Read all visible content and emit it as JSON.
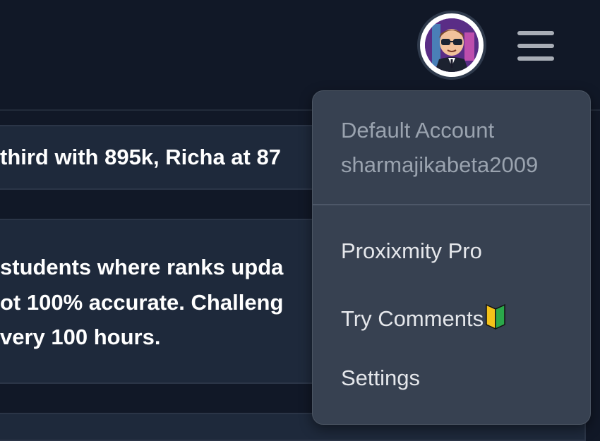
{
  "header": {
    "avatar_icon": "user-avatar",
    "menu_icon": "hamburger-menu-icon"
  },
  "feed": {
    "card1_text": "third with 895k, Richa at 87",
    "card2_lines": [
      "students where ranks upda",
      "ot 100% accurate. Challeng",
      "very 100 hours."
    ]
  },
  "dropdown": {
    "account_label": "Default Account",
    "username": "sharmajikabeta2009",
    "items": [
      {
        "label": "Proxixmity Pro"
      },
      {
        "label": "Try Comments",
        "badge_icon": "beginner-badge-icon"
      },
      {
        "label": "Settings"
      }
    ]
  },
  "colors": {
    "background": "#111827",
    "card": "#1e293b",
    "dropdown": "#374151",
    "muted_text": "#9aa3af"
  }
}
